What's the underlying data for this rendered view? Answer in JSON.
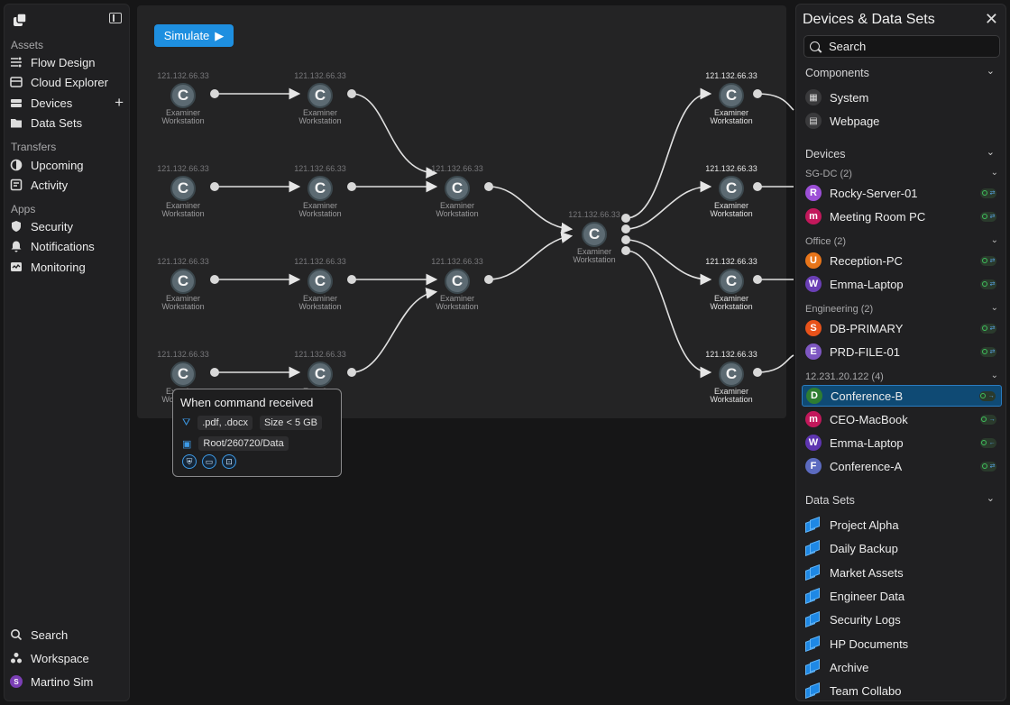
{
  "sidebar": {
    "sections": [
      {
        "title": "Assets",
        "items": [
          {
            "label": "Flow Design",
            "icon": "flow-icon"
          },
          {
            "label": "Cloud Explorer",
            "icon": "cloud-explorer-icon"
          },
          {
            "label": "Devices",
            "icon": "devices-icon"
          },
          {
            "label": "Data Sets",
            "icon": "folder-icon"
          }
        ]
      },
      {
        "title": "Transfers",
        "items": [
          {
            "label": "Upcoming",
            "icon": "clock-half-icon"
          },
          {
            "label": "Activity",
            "icon": "activity-icon"
          }
        ]
      },
      {
        "title": "Apps",
        "items": [
          {
            "label": "Security",
            "icon": "shield-icon"
          },
          {
            "label": "Notifications",
            "icon": "bell-icon"
          },
          {
            "label": "Monitoring",
            "icon": "monitoring-icon"
          }
        ]
      }
    ],
    "bottom": [
      {
        "label": "Search",
        "icon": "search-icon"
      },
      {
        "label": "Workspace",
        "icon": "workspace-icon"
      },
      {
        "label": "Martino Sim",
        "icon": "user-avatar",
        "avatar_letter": "S"
      }
    ]
  },
  "toolbar": {
    "simulate_label": "Simulate"
  },
  "flow": {
    "ip": "121.132.66.33",
    "node_label_1": "Examiner",
    "node_label_2": "Workstation",
    "node_glyph": "C"
  },
  "popup": {
    "title": "When command received",
    "filter_types": ".pdf, .docx",
    "filter_size": "Size < 5 GB",
    "path": "Root/260720/Data"
  },
  "panel": {
    "title": "Devices & Data Sets",
    "search_placeholder": "Search",
    "components_title": "Components",
    "components": [
      {
        "label": "System",
        "icon": "grid-icon"
      },
      {
        "label": "Webpage",
        "icon": "webpage-icon"
      }
    ],
    "devices_title": "Devices",
    "groups": [
      {
        "title": "SG-DC (2)",
        "items": [
          {
            "label": "Rocky-Server-01",
            "letter": "R",
            "color": "#9c4fd6"
          },
          {
            "label": "Meeting Room PC",
            "letter": "m",
            "color": "#c2185b"
          }
        ]
      },
      {
        "title": "Office (2)",
        "items": [
          {
            "label": "Reception-PC",
            "letter": "U",
            "color": "#e8751a"
          },
          {
            "label": "Emma-Laptop",
            "letter": "W",
            "color": "#6a3fb5"
          }
        ]
      },
      {
        "title": "Engineering (2)",
        "items": [
          {
            "label": "DB-PRIMARY",
            "letter": "S",
            "color": "#e8521a"
          },
          {
            "label": "PRD-FILE-01",
            "letter": "E",
            "color": "#7e57c2"
          }
        ]
      },
      {
        "title": "12.231.20.122 (4)",
        "items": [
          {
            "label": "Conference-B",
            "letter": "D",
            "color": "#2e7d32"
          },
          {
            "label": "CEO-MacBook",
            "letter": "m",
            "color": "#c2185b"
          },
          {
            "label": "Emma-Laptop",
            "letter": "W",
            "color": "#5e35b1"
          },
          {
            "label": "Conference-A",
            "letter": "F",
            "color": "#5c6bc0"
          }
        ]
      }
    ],
    "datasets_title": "Data Sets",
    "datasets": [
      "Project Alpha",
      "Daily Backup",
      "Market Assets",
      "Engineer Data",
      "Security Logs",
      "HP Documents",
      "Archive",
      "Team Collabo"
    ]
  }
}
